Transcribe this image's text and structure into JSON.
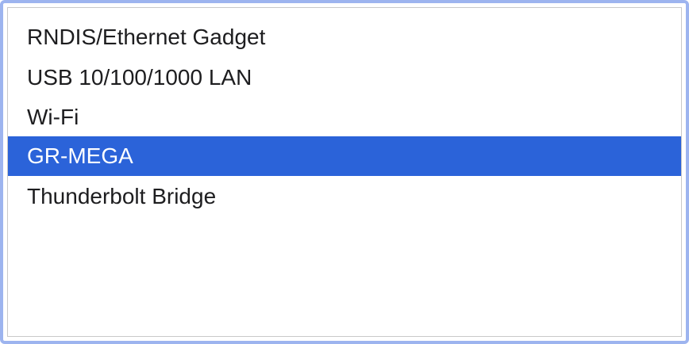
{
  "list": {
    "items": [
      {
        "label": "RNDIS/Ethernet Gadget",
        "selected": false
      },
      {
        "label": "USB 10/100/1000 LAN",
        "selected": false
      },
      {
        "label": "Wi-Fi",
        "selected": false
      },
      {
        "label": "GR-MEGA",
        "selected": true
      },
      {
        "label": "Thunderbolt Bridge",
        "selected": false
      }
    ]
  },
  "colors": {
    "focus_ring": "#9db4ef",
    "selection": "#2b63d9"
  }
}
